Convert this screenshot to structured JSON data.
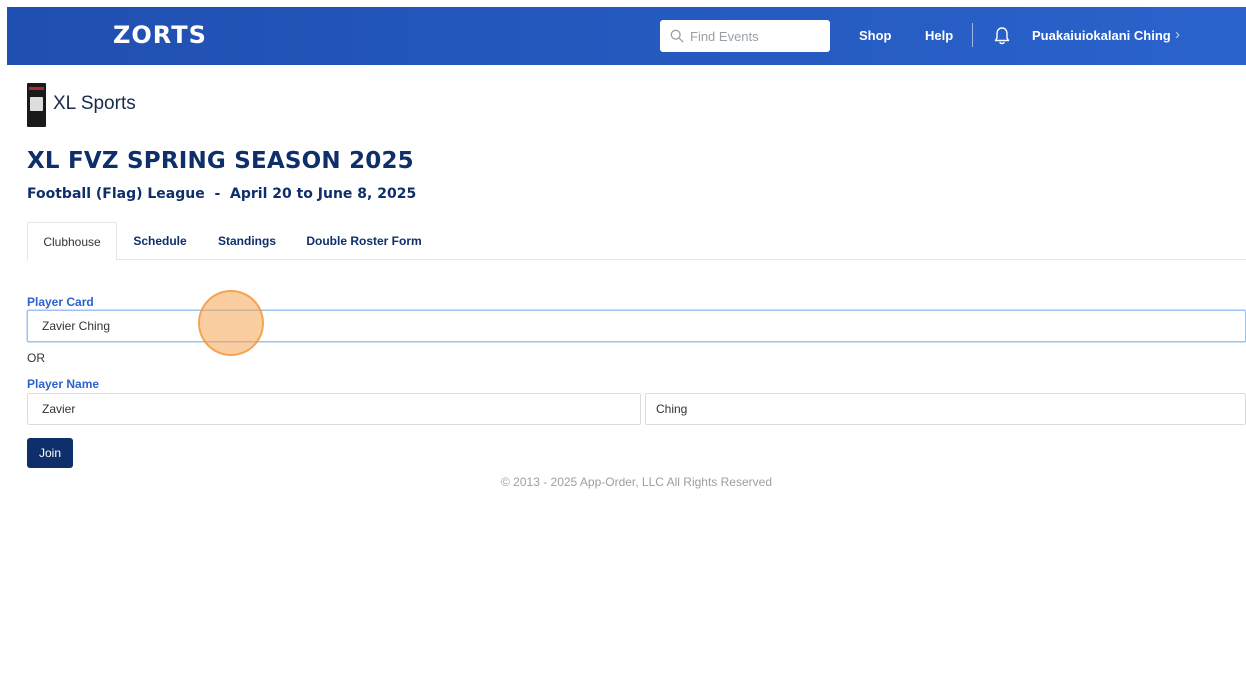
{
  "header": {
    "logo_text": "ZORTS",
    "search_placeholder": "Find Events",
    "nav": {
      "shop": "Shop",
      "help": "Help"
    },
    "user_name": "Puakaiuiokalani Ching",
    "colors": {
      "bar": "#2a63cc",
      "text": "#ffffff"
    }
  },
  "org": {
    "name": "XL Sports"
  },
  "event": {
    "title": "XL FVZ SPRING SEASON 2025",
    "subtitle": "Football (Flag) League  -  April 20 to June 8, 2025"
  },
  "tabs": [
    {
      "label": "Clubhouse",
      "active": true
    },
    {
      "label": "Schedule",
      "active": false
    },
    {
      "label": "Standings",
      "active": false
    },
    {
      "label": "Double Roster Form",
      "active": false
    }
  ],
  "form": {
    "player_card_label": "Player Card",
    "player_card_value": "Zavier Ching",
    "or_text": "OR",
    "player_name_label": "Player Name",
    "first_name_value": "Zavier",
    "last_name_value": "Ching",
    "join_label": "Join"
  },
  "footer": {
    "text": "© 2013 - 2025 App-Order, LLC All Rights Reserved"
  },
  "theme": {
    "primary_navy": "#0f2f6b",
    "accent_blue": "#2a63cc"
  }
}
